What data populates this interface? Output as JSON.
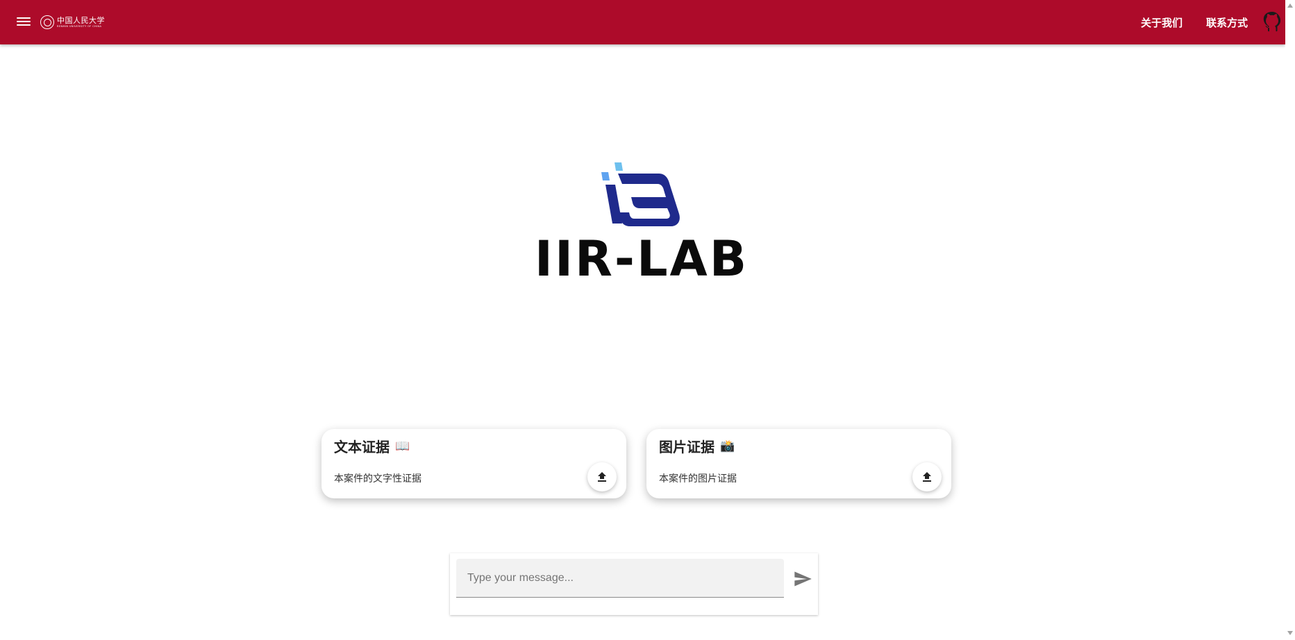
{
  "header": {
    "brand_cn": "中国人民大学",
    "brand_en": "RENMIN UNIVERSITY OF CHINA",
    "nav": [
      {
        "label": "关于我们"
      },
      {
        "label": "联系方式"
      }
    ],
    "github_icon": "github-icon"
  },
  "logo": {
    "wordmark": "IIR-LAB",
    "colors": {
      "dark_blue": "#1f2a8c",
      "light_blue": "#5fa3f0"
    }
  },
  "cards": [
    {
      "title": "文本证据",
      "emoji": "📖",
      "description": "本案件的文字性证据",
      "icon": "upload-icon"
    },
    {
      "title": "图片证据",
      "emoji": "📸",
      "description": "本案件的图片证据",
      "icon": "upload-icon"
    }
  ],
  "chat": {
    "placeholder": "Type your message...",
    "value": "",
    "send_icon": "send-icon"
  },
  "colors": {
    "appbar": "#ad0b2a"
  }
}
